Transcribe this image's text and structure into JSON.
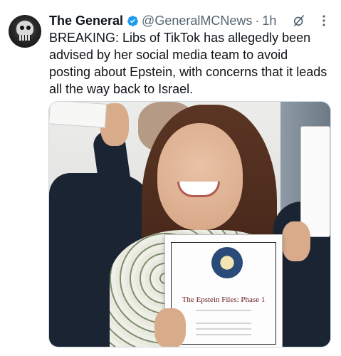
{
  "tweet": {
    "author_name": "The General",
    "handle": "@GeneralMCNews",
    "separator": "·",
    "time": "1h",
    "text": "BREAKING: Libs of TikTok has allegedly been advised by her social media team to avoid posting about Epstein, with concerns that it leads all the way back to Israel."
  },
  "media": {
    "document_title": "The Epstein Files: Phase 1"
  },
  "icons": {
    "avatar": "skull-avatar",
    "verified": "verified-badge-icon",
    "grok": "grok-icon",
    "more": "more-options-icon"
  },
  "colors": {
    "verified_blue": "#1d9bf0",
    "text_primary": "#0f1419",
    "text_secondary": "#536471"
  }
}
